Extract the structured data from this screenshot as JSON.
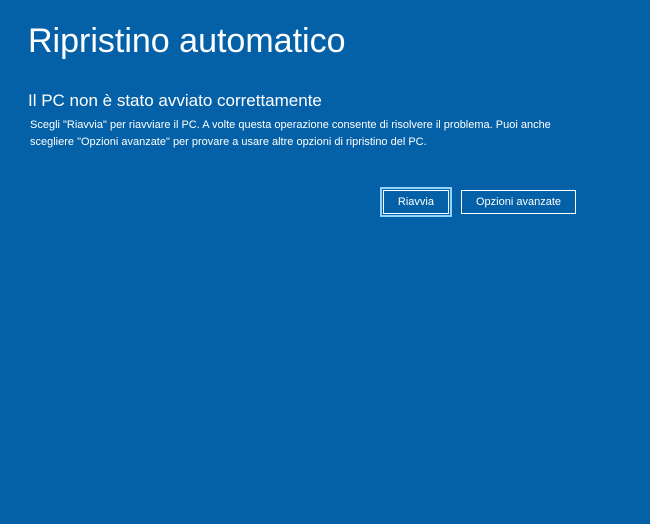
{
  "colors": {
    "background": "#0461a7",
    "text": "#ffffff",
    "focus_outline": "#8fd3ff"
  },
  "header": {
    "title": "Ripristino automatico"
  },
  "main": {
    "subtitle": "Il PC non è stato avviato correttamente",
    "description": "Scegli \"Riavvia\" per riavviare il PC. A volte questa operazione consente di risolvere il problema. Puoi anche scegliere \"Opzioni avanzate\" per provare a usare altre opzioni di ripristino del PC."
  },
  "buttons": {
    "primary_label": "Riavvia",
    "secondary_label": "Opzioni avanzate"
  }
}
